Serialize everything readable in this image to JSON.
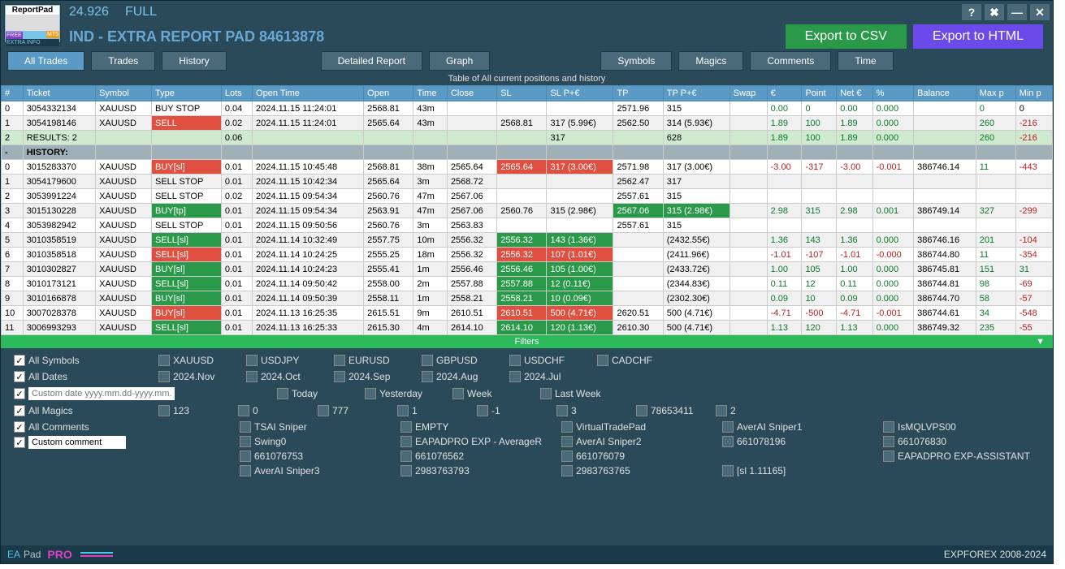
{
  "titlebar": {
    "version": "24.926",
    "full": "FULL",
    "help": "?",
    "tools": "✖",
    "min": "—",
    "close": "✕"
  },
  "header": {
    "badge": {
      "rp": "ReportPad",
      "free": "FREE",
      "mts": "MT5",
      "extra": "EXTRA INFO"
    },
    "title": "IND - EXTRA REPORT PAD 84613878",
    "csv": "Export to CSV",
    "html": "Export to HTML"
  },
  "tabs": {
    "all": "All Trades",
    "trades": "Trades",
    "history": "History",
    "report": "Detailed Report",
    "graph": "Graph",
    "symbols": "Symbols",
    "magics": "Magics",
    "comments": "Comments",
    "time": "Time"
  },
  "table_title": "Table of All current positions and history",
  "cols": [
    "#",
    "Ticket",
    "Symbol",
    "Type",
    "Lots",
    "Open Time",
    "Open",
    "Time",
    "Close",
    "SL",
    "SL P+€",
    "TP",
    "TP P+€",
    "Swap",
    "€",
    "Point",
    "Net €",
    "%",
    "Balance",
    "Max p",
    "Min p"
  ],
  "rows": [
    {
      "i": "0",
      "tk": "3054332134",
      "sy": "XAUUSD",
      "ty": "BUY STOP",
      "tc": "",
      "lo": "0.04",
      "ot": "2024.11.15 11:24:01",
      "op": "2568.81",
      "tm": "43m",
      "cl": "",
      "sl": "",
      "slp": "",
      "tp": "2571.96",
      "tpp": "315",
      "sw": "",
      "eur": "0.00",
      "ec": "g",
      "pt": "0",
      "ne": "0.00",
      "nc": "g",
      "pc": "0.000",
      "pcc": "g",
      "ba": "",
      "mx": "0",
      "mn": "0"
    },
    {
      "i": "1",
      "tk": "3054198146",
      "sy": "XAUUSD",
      "ty": "SELL",
      "tc": "r",
      "lo": "0.02",
      "ot": "2024.11.15 11:24:01",
      "op": "2565.64",
      "tm": "43m",
      "cl": "",
      "sl": "2568.81",
      "slp": "317 (5.99€)",
      "tp": "2562.50",
      "tpp": "314 (5.93€)",
      "sw": "",
      "eur": "1.89",
      "ec": "g",
      "pt": "100",
      "ne": "1.89",
      "nc": "g",
      "pc": "0.000",
      "pcc": "g",
      "ba": "",
      "mx": "260",
      "mn": "-216",
      "mnc": "r"
    },
    {
      "i": "2",
      "tk": "RESULTS: 2",
      "sy": "",
      "ty": "",
      "tc": "",
      "lo": "0.06",
      "ot": "",
      "op": "",
      "tm": "",
      "cl": "",
      "sl": "",
      "slp": "317",
      "tp": "",
      "tpp": "628",
      "sw": "",
      "eur": "1.89",
      "ec": "g",
      "pt": "100",
      "ne": "1.89",
      "nc": "g",
      "pc": "0.000",
      "pcc": "g",
      "ba": "",
      "mx": "260",
      "mn": "-216",
      "mnc": "r",
      "cls": "results"
    },
    {
      "i": "-",
      "tk": "HISTORY:",
      "sy": "",
      "ty": "",
      "tc": "",
      "lo": "",
      "ot": "",
      "op": "",
      "tm": "",
      "cl": "",
      "sl": "",
      "slp": "",
      "tp": "",
      "tpp": "",
      "sw": "",
      "eur": "",
      "ec": "",
      "pt": "",
      "ne": "",
      "nc": "",
      "pc": "",
      "pcc": "",
      "ba": "",
      "mx": "",
      "mn": "",
      "cls": "history"
    },
    {
      "i": "0",
      "tk": "3015283370",
      "sy": "XAUUSD",
      "ty": "BUY[sl]",
      "tc": "r",
      "lo": "0.01",
      "ot": "2024.11.15 10:45:48",
      "op": "2568.81",
      "tm": "38m",
      "cl": "2565.64",
      "sl": "2565.64",
      "slc": "r",
      "slp": "317 (3.00€)",
      "slpc": "r",
      "tp": "2571.98",
      "tpp": "317 (3.00€)",
      "sw": "",
      "eur": "-3.00",
      "ec": "r",
      "pt": "-317",
      "ptc": "r",
      "ne": "-3.00",
      "nc": "r",
      "pc": "-0.001",
      "pcc": "r",
      "ba": "386746.14",
      "mx": "11",
      "mxc": "g",
      "mn": "-443",
      "mnc": "r"
    },
    {
      "i": "1",
      "tk": "3054179600",
      "sy": "XAUUSD",
      "ty": "SELL STOP",
      "tc": "",
      "lo": "0.01",
      "ot": "2024.11.15 10:42:34",
      "op": "2565.64",
      "tm": "3m",
      "cl": "2568.72",
      "sl": "",
      "slp": "",
      "tp": "2562.47",
      "tpp": "317",
      "sw": "",
      "eur": "",
      "ec": "",
      "pt": "",
      "ne": "",
      "nc": "",
      "pc": "",
      "pcc": "",
      "ba": "",
      "mx": "",
      "mn": ""
    },
    {
      "i": "2",
      "tk": "3053991224",
      "sy": "XAUUSD",
      "ty": "SELL STOP",
      "tc": "",
      "lo": "0.02",
      "ot": "2024.11.15 09:54:34",
      "op": "2560.76",
      "tm": "47m",
      "cl": "2567.06",
      "sl": "",
      "slp": "",
      "tp": "2557.61",
      "tpp": "315",
      "sw": "",
      "eur": "",
      "ec": "",
      "pt": "",
      "ne": "",
      "nc": "",
      "pc": "",
      "pcc": "",
      "ba": "",
      "mx": "",
      "mn": ""
    },
    {
      "i": "3",
      "tk": "3015130228",
      "sy": "XAUUSD",
      "ty": "BUY[tp]",
      "tc": "g",
      "lo": "0.01",
      "ot": "2024.11.15 09:54:34",
      "op": "2563.91",
      "tm": "47m",
      "cl": "2567.06",
      "sl": "2560.76",
      "slp": "315 (2.98€)",
      "tp": "2567.06",
      "tpc": "g",
      "tpp": "315 (2.98€)",
      "tppc": "g",
      "sw": "",
      "eur": "2.98",
      "ec": "g",
      "pt": "315",
      "ptc": "g",
      "ne": "2.98",
      "nc": "g",
      "pc": "0.001",
      "pcc": "g",
      "ba": "386749.14",
      "mx": "327",
      "mxc": "g",
      "mn": "-299",
      "mnc": "r"
    },
    {
      "i": "4",
      "tk": "3053982942",
      "sy": "XAUUSD",
      "ty": "SELL STOP",
      "tc": "",
      "lo": "0.01",
      "ot": "2024.11.15 09:50:56",
      "op": "2560.76",
      "tm": "3m",
      "cl": "2563.83",
      "sl": "",
      "slp": "",
      "tp": "2557.61",
      "tpp": "315",
      "sw": "",
      "eur": "",
      "ec": "",
      "pt": "",
      "ne": "",
      "nc": "",
      "pc": "",
      "pcc": "",
      "ba": "",
      "mx": "",
      "mn": ""
    },
    {
      "i": "5",
      "tk": "3010358519",
      "sy": "XAUUSD",
      "ty": "SELL[sl]",
      "tc": "g",
      "lo": "0.01",
      "ot": "2024.11.14 10:32:49",
      "op": "2557.75",
      "tm": "10m",
      "cl": "2556.32",
      "sl": "2556.32",
      "slc": "g",
      "slp": "143 (1.36€)",
      "slpc": "g",
      "tp": "",
      "tpp": "(2432.55€)",
      "sw": "",
      "eur": "1.36",
      "ec": "g",
      "pt": "143",
      "ptc": "g",
      "ne": "1.36",
      "nc": "g",
      "pc": "0.000",
      "pcc": "g",
      "ba": "386746.16",
      "mx": "201",
      "mxc": "g",
      "mn": "-104",
      "mnc": "r"
    },
    {
      "i": "6",
      "tk": "3010358518",
      "sy": "XAUUSD",
      "ty": "SELL[sl]",
      "tc": "r",
      "lo": "0.01",
      "ot": "2024.11.14 10:24:25",
      "op": "2555.25",
      "tm": "18m",
      "cl": "2556.32",
      "sl": "2556.32",
      "slc": "r",
      "slp": "107 (1.01€)",
      "slpc": "r",
      "tp": "",
      "tpp": "(2411.96€)",
      "sw": "",
      "eur": "-1.01",
      "ec": "r",
      "pt": "-107",
      "ptc": "r",
      "ne": "-1.01",
      "nc": "r",
      "pc": "-0.000",
      "pcc": "r",
      "ba": "386744.80",
      "mx": "11",
      "mxc": "g",
      "mn": "-354",
      "mnc": "r"
    },
    {
      "i": "7",
      "tk": "3010302827",
      "sy": "XAUUSD",
      "ty": "BUY[sl]",
      "tc": "g",
      "lo": "0.01",
      "ot": "2024.11.14 10:24:23",
      "op": "2555.41",
      "tm": "1m",
      "cl": "2556.46",
      "sl": "2556.46",
      "slc": "g",
      "slp": "105 (1.00€)",
      "slpc": "g",
      "tp": "",
      "tpp": "(2433.72€)",
      "sw": "",
      "eur": "1.00",
      "ec": "g",
      "pt": "105",
      "ptc": "g",
      "ne": "1.00",
      "nc": "g",
      "pc": "0.000",
      "pcc": "g",
      "ba": "386745.81",
      "mx": "151",
      "mxc": "g",
      "mn": "31",
      "mnc": "g"
    },
    {
      "i": "8",
      "tk": "3010173121",
      "sy": "XAUUSD",
      "ty": "SELL[sl]",
      "tc": "g",
      "lo": "0.01",
      "ot": "2024.11.14 09:50:42",
      "op": "2558.00",
      "tm": "2m",
      "cl": "2557.88",
      "sl": "2557.88",
      "slc": "g",
      "slp": "12 (0.11€)",
      "slpc": "g",
      "tp": "",
      "tpp": "(2344.83€)",
      "sw": "",
      "eur": "0.11",
      "ec": "g",
      "pt": "12",
      "ptc": "g",
      "ne": "0.11",
      "nc": "g",
      "pc": "0.000",
      "pcc": "g",
      "ba": "386744.81",
      "mx": "98",
      "mxc": "g",
      "mn": "-69",
      "mnc": "r"
    },
    {
      "i": "9",
      "tk": "3010166878",
      "sy": "XAUUSD",
      "ty": "BUY[sl]",
      "tc": "g",
      "lo": "0.01",
      "ot": "2024.11.14 09:50:39",
      "op": "2558.11",
      "tm": "1m",
      "cl": "2558.21",
      "sl": "2558.21",
      "slc": "g",
      "slp": "10 (0.09€)",
      "slpc": "g",
      "tp": "",
      "tpp": "(2302.30€)",
      "sw": "",
      "eur": "0.09",
      "ec": "g",
      "pt": "10",
      "ptc": "g",
      "ne": "0.09",
      "nc": "g",
      "pc": "0.000",
      "pcc": "g",
      "ba": "386744.70",
      "mx": "58",
      "mxc": "g",
      "mn": "-57",
      "mnc": "r"
    },
    {
      "i": "10",
      "tk": "3007028378",
      "sy": "XAUUSD",
      "ty": "BUY[sl]",
      "tc": "r",
      "lo": "0.01",
      "ot": "2024.11.13 16:25:35",
      "op": "2615.51",
      "tm": "9m",
      "cl": "2610.51",
      "sl": "2610.51",
      "slc": "r",
      "slp": "500 (4.71€)",
      "slpc": "r",
      "tp": "2620.51",
      "tpp": "500 (4.71€)",
      "sw": "",
      "eur": "-4.71",
      "ec": "r",
      "pt": "-500",
      "ptc": "r",
      "ne": "-4.71",
      "nc": "r",
      "pc": "-0.001",
      "pcc": "r",
      "ba": "386744.61",
      "mx": "34",
      "mxc": "g",
      "mn": "-548",
      "mnc": "r"
    },
    {
      "i": "11",
      "tk": "3006993293",
      "sy": "XAUUSD",
      "ty": "SELL[sl]",
      "tc": "g",
      "lo": "0.01",
      "ot": "2024.11.13 16:25:33",
      "op": "2615.30",
      "tm": "4m",
      "cl": "2614.10",
      "sl": "2614.10",
      "slc": "g",
      "slp": "120 (1.13€)",
      "slpc": "g",
      "tp": "2610.30",
      "tpp": "500 (4.71€)",
      "sw": "",
      "eur": "1.13",
      "ec": "g",
      "pt": "120",
      "ptc": "g",
      "ne": "1.13",
      "nc": "g",
      "pc": "0.000",
      "pcc": "g",
      "ba": "386749.32",
      "mx": "235",
      "mxc": "g",
      "mn": "-55",
      "mnc": "r"
    }
  ],
  "filters_hdr": "Filters",
  "filters": {
    "symbols": {
      "label": "All Symbols",
      "items": [
        "XAUUSD",
        "USDJPY",
        "EURUSD",
        "GBPUSD",
        "USDCHF",
        "CADCHF"
      ]
    },
    "dates": {
      "label": "All Dates",
      "items": [
        "2024.Nov",
        "2024.Oct",
        "2024.Sep",
        "2024.Aug",
        "2024.Jul"
      ],
      "custom_ph": "Custom date yyyy.mm.dd-yyyy.mm.dd",
      "quick": [
        "Today",
        "Yesterday",
        "Week",
        "Last Week"
      ]
    },
    "magics": {
      "label": "All Magics",
      "items": [
        "123",
        "0",
        "777",
        "1",
        "-1",
        "3",
        "78653411",
        "2"
      ]
    },
    "comments": {
      "label": "All Comments",
      "custom": "Custom comment",
      "items": [
        "TSAI Sniper",
        "EMPTY",
        "VirtualTradePad",
        "AverAI Sniper1",
        "IsMQLVPS00",
        "Swing0",
        "EAPADPRO EXP - AverageR",
        "AverAI Sniper2",
        "661078196",
        "661076830",
        "661076753",
        "661076562",
        "661076079",
        "",
        "EAPADPRO EXP-ASSISTANT",
        "AverAI Sniper3",
        "2983763793",
        "2983763765",
        "[sl 1.11165]"
      ]
    }
  },
  "footer": {
    "ea": "EA",
    "pad": "Pad",
    "pro": "PRO",
    "copy": "EXPFOREX 2008-2024"
  }
}
